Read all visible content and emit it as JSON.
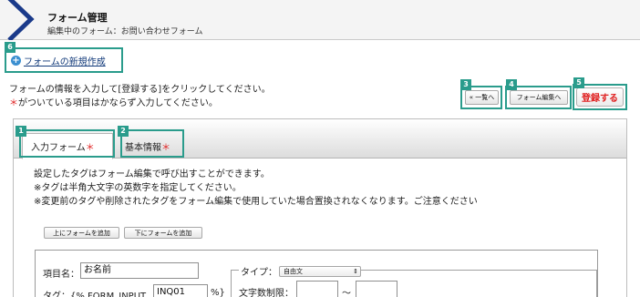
{
  "header": {
    "title": "フォーム管理",
    "subtitle": "編集中のフォーム：お問い合わせフォーム"
  },
  "badges": [
    "1",
    "2",
    "3",
    "4",
    "5",
    "6"
  ],
  "new_form_link": "フォームの新規作成",
  "instructions": {
    "line1": "フォームの情報を入力して[登録する]をクリックしてください。",
    "line2_mark": "＊",
    "line2_text": "がついている項目はかならず入力してください。"
  },
  "buttons": {
    "list": "« 一覧へ",
    "form_edit": "フォーム編集へ",
    "register": "登録する",
    "add_above": "上にフォームを追加",
    "add_below": "下にフォームを追加"
  },
  "tabs": [
    {
      "label": "入力フォーム",
      "required_mark": "＊"
    },
    {
      "label": "基本情報",
      "required_mark": "＊"
    }
  ],
  "description": [
    "設定したタグはフォーム編集で呼び出すことができます。",
    "※タグは半角大文字の英数字を指定してください。",
    "※変更前のタグや削除されたタグをフォーム編集で使用していた場合置換されなくなります。ご注意ください"
  ],
  "form_item": {
    "name_label": "項目名：",
    "name_value": "お名前",
    "tag_label_prefix": "タグ：{% FORM_INPUT_",
    "tag_value": "INQ01",
    "tag_label_suffix": "%}",
    "type_legend": "タイプ：",
    "type_value": "自由文",
    "char_limit_label": "文字数制限：",
    "range_sep": "〜"
  },
  "colors": {
    "accent": "#2a9c8c",
    "required": "#e02020",
    "link": "#123a7a",
    "header_chevron": "#1a3a8a"
  }
}
